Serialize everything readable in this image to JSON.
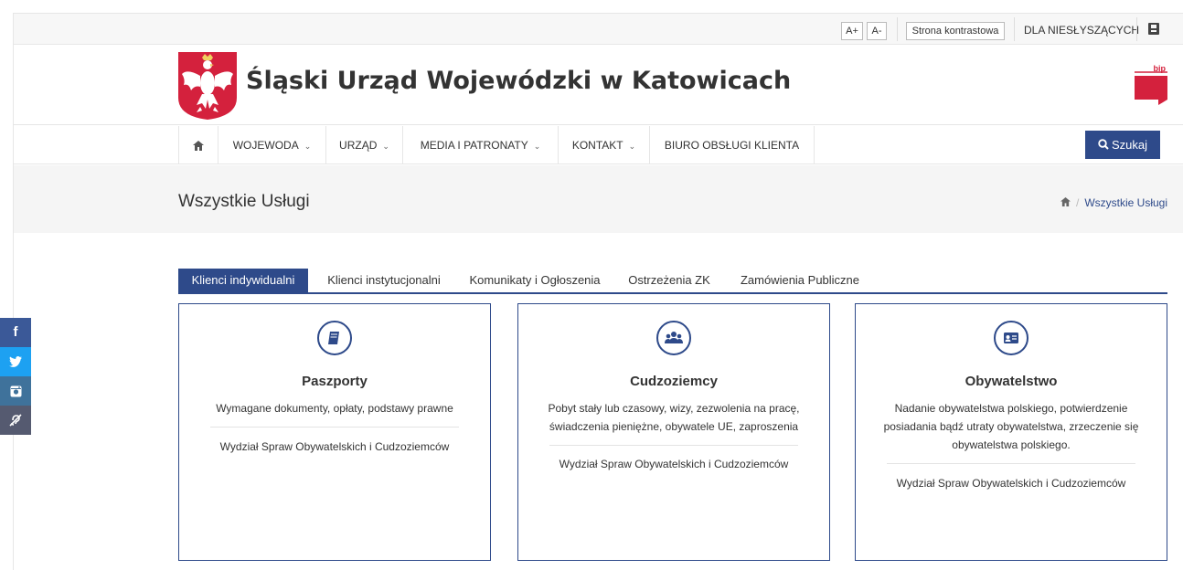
{
  "utility": {
    "font_increase": "A+",
    "font_decrease": "A-",
    "contrast": "Strona kontrastowa",
    "deaf": "DLA NIESŁYSZĄCYCH"
  },
  "header": {
    "title": "Śląski Urząd Wojewódzki w Katowicach",
    "bip_label": "bip"
  },
  "nav": {
    "items": [
      {
        "label": "WOJEWODA",
        "dropdown": true
      },
      {
        "label": "URZĄD",
        "dropdown": true
      },
      {
        "label": "MEDIA I PATRONATY",
        "dropdown": true
      },
      {
        "label": "KONTAKT",
        "dropdown": true
      },
      {
        "label": "BIURO OBSŁUGI KLIENTA",
        "dropdown": false
      }
    ],
    "search": "Szukaj"
  },
  "page": {
    "title": "Wszystkie Usługi",
    "breadcrumb": "Wszystkie Usługi"
  },
  "tabs": [
    {
      "label": "Klienci indywidualni",
      "active": true
    },
    {
      "label": "Klienci instytucjonalni",
      "active": false
    },
    {
      "label": "Komunikaty i Ogłoszenia",
      "active": false
    },
    {
      "label": "Ostrzeżenia ZK",
      "active": false
    },
    {
      "label": "Zamówienia Publiczne",
      "active": false
    }
  ],
  "cards": [
    {
      "icon": "book-icon",
      "title": "Paszporty",
      "description": "Wymagane dokumenty, opłaty, podstawy prawne",
      "department": "Wydział Spraw Obywatelskich i Cudzoziemców"
    },
    {
      "icon": "users-icon",
      "title": "Cudzoziemcy",
      "description": "Pobyt stały lub czasowy, wizy, zezwolenia na pracę, świadczenia pieniężne, obywatele UE, zaproszenia",
      "department": "Wydział Spraw Obywatelskich i Cudzoziemców"
    },
    {
      "icon": "id-card-icon",
      "title": "Obywatelstwo",
      "description": "Nadanie obywatelstwa polskiego, potwierdzenie posiadania bądź utraty obywatelstwa, zrzeczenie się obywatelstwa polskiego.",
      "department": "Wydział Spraw Obywatelskich i Cudzoziemców"
    }
  ],
  "social": [
    {
      "icon": "facebook-icon",
      "color": "#3b5998"
    },
    {
      "icon": "twitter-icon",
      "color": "#1da1f2"
    },
    {
      "icon": "instagram-icon",
      "color": "#3f729b"
    },
    {
      "icon": "deaf-icon",
      "color": "#555a70"
    }
  ],
  "colors": {
    "accent": "#2e4a8a",
    "emblem_red": "#d4213d"
  }
}
